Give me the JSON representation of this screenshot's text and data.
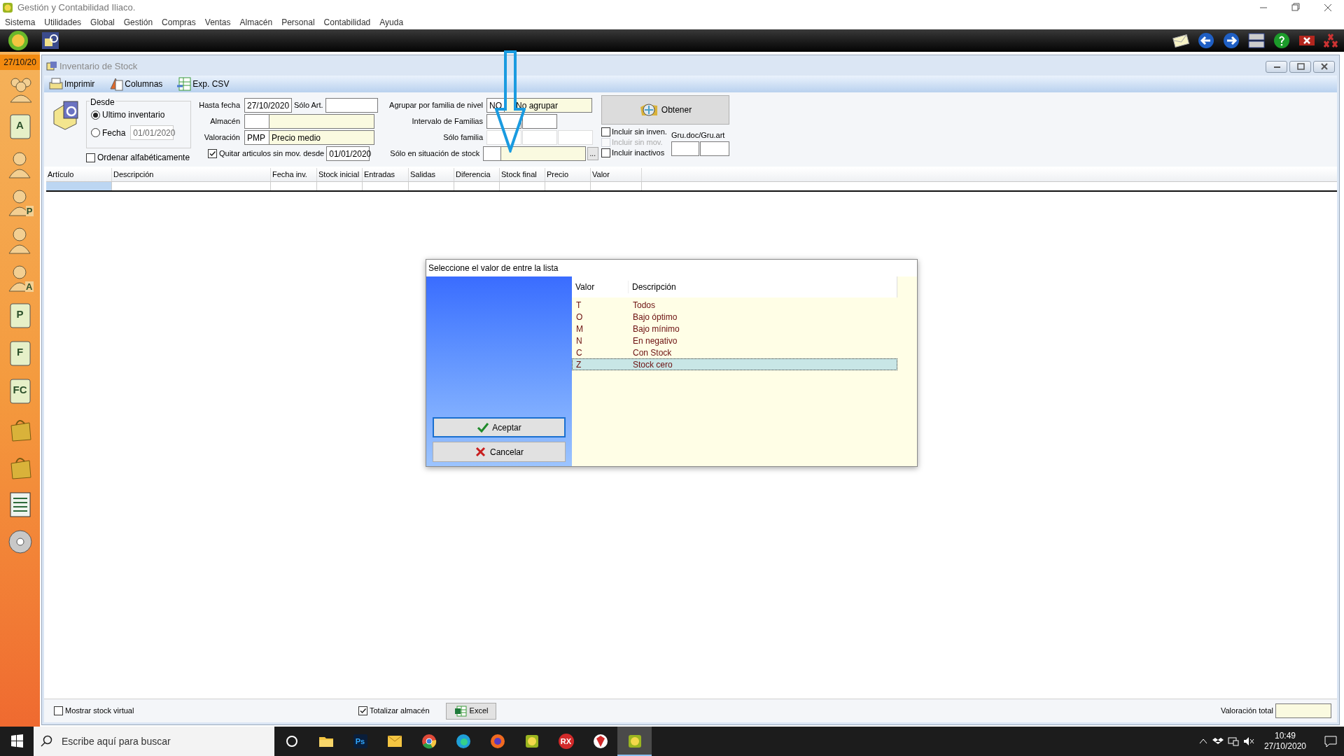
{
  "app_title": "Gestión y Contabilidad Iliaco.",
  "menu": [
    "Sistema",
    "Utilidades",
    "Global",
    "Gestión",
    "Compras",
    "Ventas",
    "Almacén",
    "Personal",
    "Contabilidad",
    "Ayuda"
  ],
  "sidebar": {
    "date": "27/10/20",
    "items": [
      {
        "kind": "group"
      },
      {
        "kind": "letter",
        "letter": "A"
      },
      {
        "kind": "person"
      },
      {
        "kind": "person",
        "letter": "P"
      },
      {
        "kind": "person"
      },
      {
        "kind": "person",
        "letter": "A"
      },
      {
        "kind": "letter",
        "letter": "P"
      },
      {
        "kind": "letter",
        "letter": "F"
      },
      {
        "kind": "letter",
        "letter": "FC"
      },
      {
        "kind": "bag"
      },
      {
        "kind": "bag"
      },
      {
        "kind": "list"
      },
      {
        "kind": "disc"
      }
    ]
  },
  "window": {
    "title": "Inventario de Stock",
    "toolbar": [
      {
        "kind": "print",
        "label": "Imprimir"
      },
      {
        "kind": "columns",
        "label": "Columnas"
      },
      {
        "kind": "csv",
        "label": "Exp. CSV"
      }
    ]
  },
  "form": {
    "desde": {
      "label": "Desde",
      "options": [
        {
          "label": "Ultimo inventario",
          "selected": true
        },
        {
          "label": "Fecha",
          "selected": false,
          "value": "01/01/2020",
          "disabled": true
        }
      ]
    },
    "ordenar": {
      "label": "Ordenar alfabéticamente",
      "checked": false
    },
    "hasta_fecha": {
      "label": "Hasta fecha",
      "value": "27/10/2020"
    },
    "solo_art": {
      "label": "Sólo Art."
    },
    "almacen": {
      "label": "Almacén"
    },
    "valoracion": {
      "label": "Valoración",
      "code": "PMP",
      "description": "Precio medio"
    },
    "quitar": {
      "label": "Quitar articulos sin mov. desde",
      "checked": true,
      "value": "01/01/2020"
    },
    "agrupar": {
      "label": "Agrupar por familia de nivel",
      "code": "NO",
      "description": "No agrupar"
    },
    "intervalo": {
      "label": "Intervalo de Familias"
    },
    "solo_familia": {
      "label": "Sólo familia"
    },
    "situacion": {
      "label": "Sólo en situación de stock",
      "button": "..."
    },
    "obtener": "Obtener",
    "checks": [
      {
        "label": "Incluir sin inven.",
        "checked": false,
        "disabled": false
      },
      {
        "label": "Incluir sin mov.",
        "checked": false,
        "disabled": true
      },
      {
        "label": "Incluir inactivos",
        "checked": false,
        "disabled": false
      }
    ],
    "gru_label": "Gru.doc/Gru.art"
  },
  "table": {
    "columns": [
      "Artículo",
      "Descripción",
      "Fecha inv.",
      "Stock inicial",
      "Entradas",
      "Salidas",
      "Diferencia",
      "Stock final",
      "Precio",
      "Valor"
    ]
  },
  "dialog": {
    "title": "Seleccione el valor de entre la lista",
    "columns": [
      "Valor",
      "Descripción"
    ],
    "rows": [
      {
        "value": "T",
        "description": "Todos",
        "selected": false
      },
      {
        "value": "O",
        "description": "Bajo óptimo",
        "selected": false
      },
      {
        "value": "M",
        "description": "Bajo mínimo",
        "selected": false
      },
      {
        "value": "N",
        "description": "En negativo",
        "selected": false
      },
      {
        "value": "C",
        "description": "Con Stock",
        "selected": false
      },
      {
        "value": "Z",
        "description": "Stock cero",
        "selected": true
      }
    ],
    "buttons": [
      {
        "kind": "accept",
        "label": "Aceptar"
      },
      {
        "kind": "cancel",
        "label": "Cancelar"
      }
    ]
  },
  "footer": {
    "mostrar": {
      "label": "Mostrar stock virtual",
      "checked": false
    },
    "totalizar": {
      "label": "Totalizar almacén",
      "checked": true
    },
    "excel": "Excel",
    "valoracion_total": "Valoración total"
  },
  "taskbar": {
    "search_placeholder": "Escribe aquí para buscar",
    "apps": [
      {
        "kind": "circle",
        "selected": false
      },
      {
        "kind": "folder",
        "selected": false
      },
      {
        "kind": "ps",
        "label": "Ps",
        "selected": false
      },
      {
        "kind": "mail",
        "selected": false
      },
      {
        "kind": "chrome",
        "selected": false
      },
      {
        "kind": "edge",
        "selected": false
      },
      {
        "kind": "firefox",
        "selected": false
      },
      {
        "kind": "app",
        "selected": false
      },
      {
        "kind": "rx",
        "label": "RX",
        "selected": false
      },
      {
        "kind": "shield",
        "selected": false
      },
      {
        "kind": "app",
        "selected": true
      }
    ],
    "time": "10:49",
    "date": "27/10/2020"
  }
}
